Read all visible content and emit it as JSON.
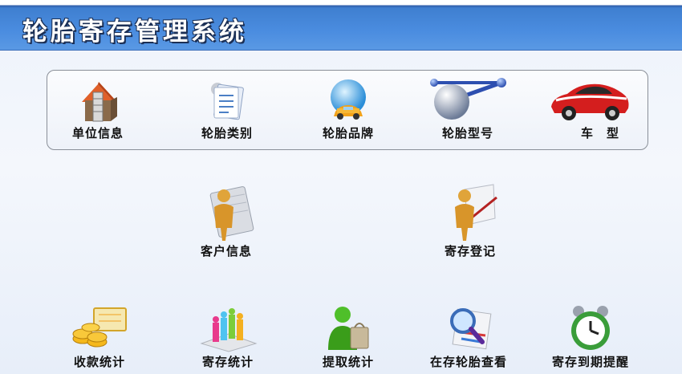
{
  "app": {
    "title": "轮胎寄存管理系统"
  },
  "settings": [
    {
      "label": "单位信息",
      "icon": "house-icon"
    },
    {
      "label": "轮胎类别",
      "icon": "document-list-icon"
    },
    {
      "label": "轮胎品牌",
      "icon": "globe-car-icon"
    },
    {
      "label": "轮胎型号",
      "icon": "molecule-icon"
    },
    {
      "label": "车　型",
      "icon": "sports-car-icon"
    }
  ],
  "main": [
    {
      "label": "客户信息",
      "icon": "user-figure-icon"
    },
    {
      "label": "寄存登记",
      "icon": "user-register-icon"
    }
  ],
  "stats": [
    {
      "label": "收款统计",
      "icon": "coins-icon"
    },
    {
      "label": "寄存统计",
      "icon": "bar-people-icon"
    },
    {
      "label": "提取统计",
      "icon": "user-bag-icon"
    },
    {
      "label": "在存轮胎查看",
      "icon": "magnifier-icon"
    },
    {
      "label": "寄存到期提醒",
      "icon": "alarm-clock-icon"
    }
  ],
  "colors": {
    "header": "#4b8de0",
    "background": "#eef3fb"
  }
}
